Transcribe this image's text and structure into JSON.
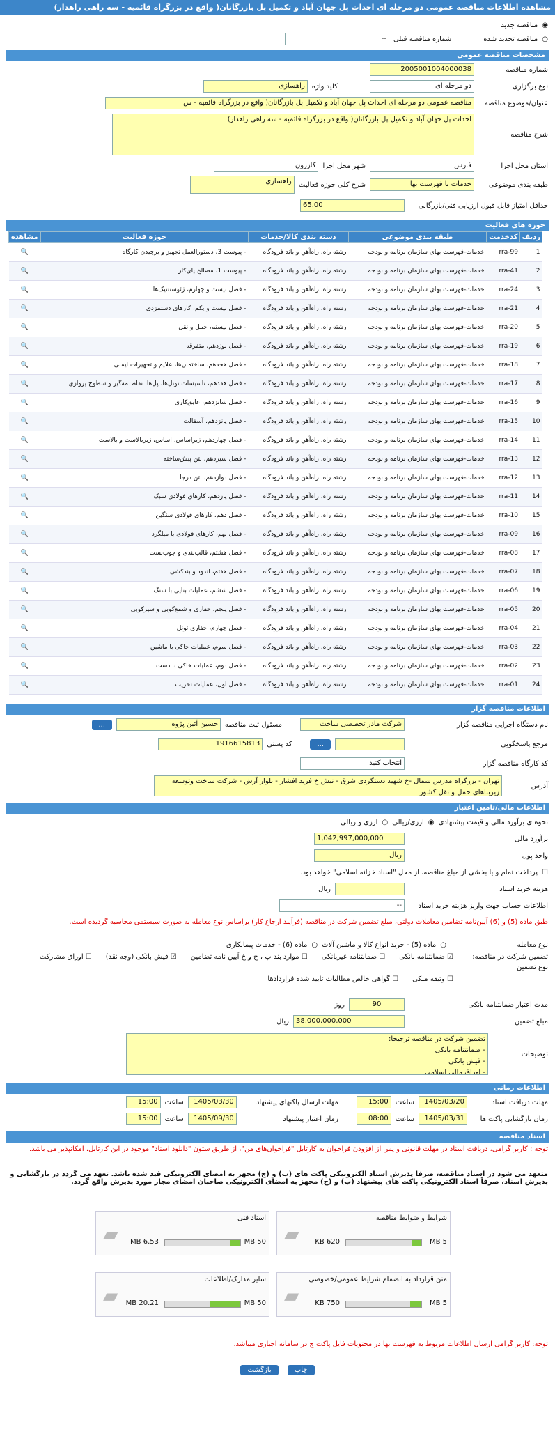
{
  "header": {
    "title": "مشاهده اطلاعات مناقصه عمومی دو مرحله ای احداث پل جهان آباد و تکمیل پل بازرگانان( واقع در بزرگراه قائمیه - سه راهی راهدار)"
  },
  "top": {
    "new": "مناقصه جدید",
    "renewed": "مناقصه تجدید شده",
    "prev_label": "شماره مناقصه قبلی",
    "prev_value": "--"
  },
  "general": {
    "section": "مشخصات مناقصه عمومی",
    "number_label": "شماره مناقصه",
    "number": "2005001004000038",
    "type_label": "نوع برگزاری",
    "type": "دو مرحله ای",
    "keyword_label": "کلید واژه",
    "keyword": "راهسازی",
    "subject_label": "عنوان/موضوع مناقصه",
    "subject": "مناقصه عمومی دو مرحله ای احداث پل جهان آباد و تکمیل پل بازرگانان( واقع در بزرگراه قائمیه - س",
    "desc_label": "شرح مناقصه",
    "desc": "احداث پل جهان آباد و تکمیل پل بازرگانان( واقع در بزرگراه قائمیه - سه راهی راهدار)",
    "province_label": "استان محل اجرا",
    "province": "فارس",
    "city_label": "شهر محل اجرا",
    "city": "کازرون",
    "class_label": "طبقه بندی موضوعی",
    "class": "خدمات با فهرست بها",
    "scope_label": "شرح کلی حوزه فعالیت",
    "scope": "راهسازی",
    "score_label": "حداقل امتیاز قابل قبول ارزیابی فنی/بازرگانی",
    "score": "65.00"
  },
  "activities": {
    "section": "حوزه های فعالیت",
    "cols": [
      "ردیف",
      "کدخدمت",
      "طبقه بندی موضوعی",
      "دسته بندی کالا/خدمات",
      "حوزه فعالیت",
      "مشاهده"
    ],
    "cls": "خدمات-فهرست بهای سازمان برنامه و بودجه",
    "grp": "رشته راه، راه‌آهن و باند فرودگاه",
    "rows": [
      [
        "1",
        "rra-99",
        "- پیوست 3، دستورالعمل تجهیز و برچیدن کارگاه"
      ],
      [
        "2",
        "rra-41",
        "- پیوست 1، مصالح پای‌کار"
      ],
      [
        "3",
        "rra-24",
        "- فصل بیست و چهارم، ژئوسنتتیک‌ها"
      ],
      [
        "4",
        "rra-21",
        "- فصل بیست و یکم، کارهای دستمزدی"
      ],
      [
        "5",
        "rra-20",
        "- فصل بیستم، حمل و نقل"
      ],
      [
        "6",
        "rra-19",
        "- فصل نوزدهم، متفرقه"
      ],
      [
        "7",
        "rra-18",
        "- فصل هجدهم، ساختمان‌ها، علایم و تجهیزات ایمنی"
      ],
      [
        "8",
        "rra-17",
        "- فصل هفدهم، تاسیسات تونل‌ها، پل‌ها، نقاط مه‌گیر و سطوح پروازی"
      ],
      [
        "9",
        "rra-16",
        "- فصل شانزدهم، عایق‌کاری"
      ],
      [
        "10",
        "rra-15",
        "- فصل پانزدهم، آسفالت"
      ],
      [
        "11",
        "rra-14",
        "- فصل چهاردهم، زیراساس، اساس، زیربالاست و بالاست"
      ],
      [
        "12",
        "rra-13",
        "- فصل سیزدهم، بتن پیش‌ساخته"
      ],
      [
        "13",
        "rra-12",
        "- فصل دوازدهم، بتن درجا"
      ],
      [
        "14",
        "rra-11",
        "- فصل یازدهم، کارهای فولادی سبک"
      ],
      [
        "15",
        "rra-10",
        "- فصل دهم، کارهای فولادی سنگین"
      ],
      [
        "16",
        "rra-09",
        "- فصل نهم، کارهای فولادی با میلگرد"
      ],
      [
        "17",
        "rra-08",
        "- فصل هشتم، قالب‌بندی و چوب‌بست"
      ],
      [
        "18",
        "rra-07",
        "- فصل هفتم، اندود و بندکشی"
      ],
      [
        "19",
        "rra-06",
        "- فصل ششم، عملیات بنایی با سنگ"
      ],
      [
        "20",
        "rra-05",
        "- فصل پنجم، حفاری و شمع‌کوبی و سپرکوبی"
      ],
      [
        "21",
        "rra-04",
        "- فصل چهارم، حفاری تونل"
      ],
      [
        "22",
        "rra-03",
        "- فصل سوم، عملیات خاکی با ماشین"
      ],
      [
        "23",
        "rra-02",
        "- فصل دوم، عملیات خاکی با دست"
      ],
      [
        "24",
        "rra-01",
        "- فصل اول، عملیات تخریب"
      ]
    ]
  },
  "organizer": {
    "section": "اطلاعات مناقصه گزار",
    "org_label": "نام دستگاه اجرایی مناقصه گزار",
    "org": "شرکت مادر تخصصی ساخت",
    "resp_label": "مسئول ثبت مناقصه",
    "resp": "حسین آئین پژوه",
    "ref_label": "مرجع پاسخگویی",
    "postal_label": "کد پستی",
    "postal": "1916615813",
    "wg_label": "کد کارگاه مناقصه گزار",
    "wg": "انتخاب کنید",
    "addr_label": "آدرس",
    "addr": "تهران - بزرگراه مدرس شمال -خ شهید دستگردی شرق - نبش خ فرید افشار  - بلوار آرش  - شرکت ساخت وتوسعه زیربناهای حمل و نقل کشور"
  },
  "finance": {
    "section": "اطلاعات مالی/تامین اعتبار",
    "method_label": "نحوه ی برآورد مالی و قیمت پیشنهادی",
    "rial": "ارزی/ریالی",
    "fx": "ارزی و ریالی",
    "est_label": "برآورد مالی",
    "est": "1,042,997,000,000",
    "cur_label": "واحد پول",
    "cur": "ریال",
    "pay_text": "پرداخت تمام و یا بخشی از مبلغ مناقصه، از محل \"اسناد خزانه اسلامی\" خواهد بود.",
    "fee_label": "هزینه خرید اسناد",
    "fee_unit": "ریال",
    "acct_label": "اطلاعات حساب جهت واریز هزینه خرید اسناد",
    "acct": "--"
  },
  "guarantee": {
    "note": "طبق ماده (5) و (6) آیین‌نامه تضامین معاملات دولتی، مبلغ تضمین شرکت در مناقصه (فرآیند ارجاع کار) براساس نوع معامله به صورت سیستمی محاسبه گردیده است.",
    "deal_label": "نوع معامله",
    "deal1": "ماده (5) - خرید انواع کالا و ماشین آلات",
    "deal2": "ماده (6) - خدمات پیمانکاری",
    "part_label": "تضمین شرکت در مناقصه:",
    "g_label": "نوع تضمین",
    "g": [
      "ضمانتنامه بانکی",
      "ضمانتنامه غیربانکی",
      "موارد بند پ ، ح و خ آیین نامه تضامین",
      "فیش بانکی (وجه نقد)",
      "اوراق مشارکت",
      "وثیقه ملکی",
      "گواهی خالص مطالبات تایید شده قراردادها"
    ],
    "days_label": "مدت اعتبار ضمانتنامه بانکی",
    "days": "90",
    "days_unit": "روز",
    "amount_label": "مبلغ تضمین",
    "amount": "38,000,000,000",
    "amount_unit": "ریال",
    "exp_label": "توضیحات",
    "exp": "تضمین شرکت در مناقصه ترجیحا:\n- ضمانتنامه بانکی\n- فیش بانکی\n- اوراق مالی اسلامی"
  },
  "time": {
    "section": "اطلاعات زمانی",
    "a": "مهلت دریافت اسناد",
    "a_d": "1405/03/20",
    "a_t": "15:00",
    "b": "مهلت ارسال پاکتهای پیشنهاد",
    "b_d": "1405/03/30",
    "b_t": "15:00",
    "c": "زمان بازگشایی پاکت ها",
    "c_d": "1405/03/31",
    "c_t": "08:00",
    "d": "زمان اعتبار پیشنهاد",
    "d_d": "1405/09/30",
    "d_t": "15:00",
    "time_lbl": "ساعت"
  },
  "docs": {
    "section": "اسناد مناقصه",
    "n1": "توجه : کاربر گرامی، دریافت اسناد در مهلت قانونی و پس از افزودن فراخوان به کارتابل \"فراخوان‌های من\"، از طریق ستون \"دانلود اسناد\" موجود در این کارتابل، امکانپذیر می باشد.",
    "n2": "متعهد می شود در اسناد مناقصه، صرفاً پذیرش اسناد الکترونیکی پاکت های (ب) و (ج) مجهز به امضای الکترونیکی قید شده باشد. تعهد می گردد در بارگشایی و پذیرش اسناد، صرفاً اسناد الکترونیکی پاکت های پیشنهاد (ب) و (ج) مجهز به امضای الکترونیکی صاحبان امضای مجاز مورد پذیرش واقع گردد.",
    "items": [
      {
        "t": "شرایط و ضوابط مناقصه",
        "s": "620 KB",
        "m": "5 MB",
        "f": 0.12
      },
      {
        "t": "اسناد فنی",
        "s": "6.53 MB",
        "m": "50 MB",
        "f": 0.13
      },
      {
        "t": "متن قرارداد به انضمام شرایط عمومی/خصوصی",
        "s": "750 KB",
        "m": "5 MB",
        "f": 0.15
      },
      {
        "t": "سایر مدارک/اطلاعات",
        "s": "20.21 MB",
        "m": "50 MB",
        "f": 0.4
      }
    ],
    "n3": "توجه: کاربر گرامی ارسال اطلاعات مربوط به فهرست بها در محتویات فایل پاکت ج در سامانه اجباری میباشد.",
    "print": "چاپ",
    "back": "بازگشت"
  }
}
